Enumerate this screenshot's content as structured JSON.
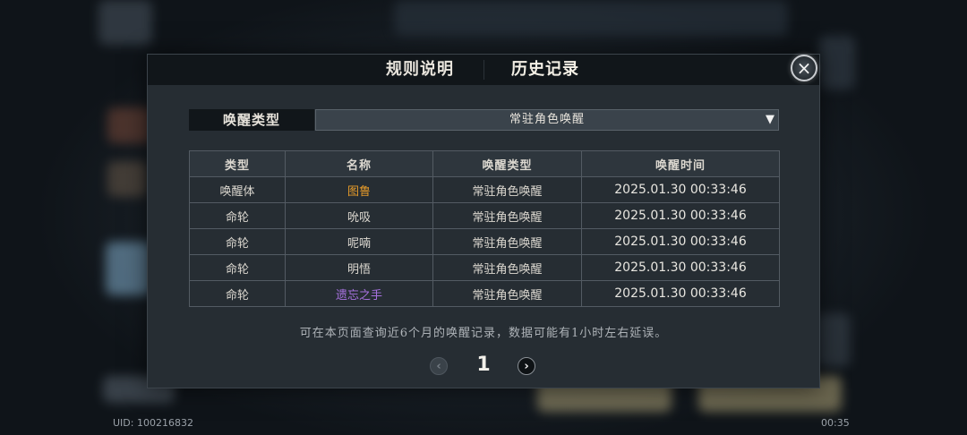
{
  "tabs": {
    "rules": "规则说明",
    "history": "历史记录"
  },
  "close_icon": "×",
  "filter": {
    "label": "唤醒类型",
    "selected": "常驻角色唤醒",
    "arrow_icon": "▼"
  },
  "table": {
    "headers": [
      "类型",
      "名称",
      "唤醒类型",
      "唤醒时间"
    ],
    "rows": [
      {
        "type": "唤醒体",
        "name": "图鲁",
        "name_color": "#e59a2a",
        "wake_type": "常驻角色唤醒",
        "time": "2025.01.30 00:33:46"
      },
      {
        "type": "命轮",
        "name": "吮吸",
        "name_color": "#dcd8d0",
        "wake_type": "常驻角色唤醒",
        "time": "2025.01.30 00:33:46"
      },
      {
        "type": "命轮",
        "name": "呢喃",
        "name_color": "#dcd8d0",
        "wake_type": "常驻角色唤醒",
        "time": "2025.01.30 00:33:46"
      },
      {
        "type": "命轮",
        "name": "明悟",
        "name_color": "#dcd8d0",
        "wake_type": "常驻角色唤醒",
        "time": "2025.01.30 00:33:46"
      },
      {
        "type": "命轮",
        "name": "遗忘之手",
        "name_color": "#a872e0",
        "wake_type": "常驻角色唤醒",
        "time": "2025.01.30 00:33:46"
      }
    ]
  },
  "notice": "可在本页面查询近6个月的唤醒记录，数据可能有1小时左右延误。",
  "pagination": {
    "prev_icon": "‹",
    "current": "1",
    "next_icon": "›"
  },
  "footer": {
    "uid": "UID: 100216832",
    "clock": "00:35"
  }
}
